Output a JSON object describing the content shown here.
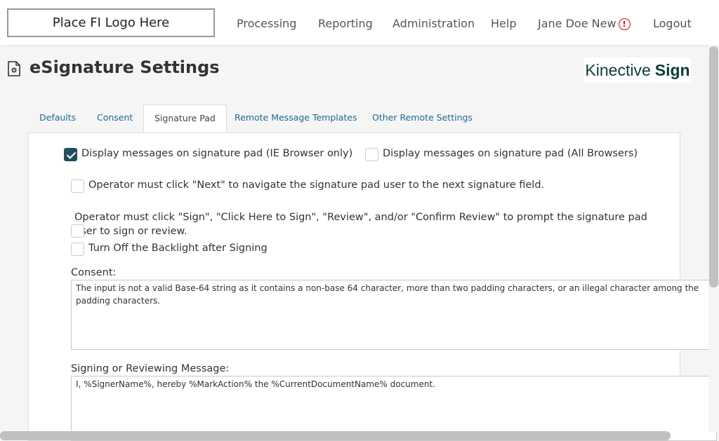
{
  "header": {
    "logo_placeholder": "Place FI Logo Here",
    "nav": {
      "processing": "Processing",
      "reporting": "Reporting",
      "administration": "Administration",
      "help": "Help",
      "user": "Jane Doe New",
      "alert_symbol": "!",
      "logout": "Logout"
    }
  },
  "page": {
    "title": "eSignature Settings",
    "icon": "settings-document-icon",
    "brand_primary": "Kinective",
    "brand_secondary": "Sign"
  },
  "tabs": {
    "defaults": "Defaults",
    "consent": "Consent",
    "signature_pad": "Signature Pad",
    "remote_templates": "Remote Message Templates",
    "other_remote": "Other Remote Settings",
    "active": "Signature Pad"
  },
  "settings": {
    "display_ie": {
      "label": "Display messages on signature pad (IE Browser only)",
      "checked": true
    },
    "display_all": {
      "label": "Display messages on signature pad (All Browsers)",
      "checked": false
    },
    "click_next": {
      "label": "Operator must click \"Next\" to navigate the signature pad user to the next signature field.",
      "checked": false
    },
    "click_sign": {
      "label": "Operator must click \"Sign\", \"Click Here to Sign\", \"Review\", and/or \"Confirm Review\" to prompt the signature pad user to sign or review.",
      "checked": false
    },
    "backlight": {
      "label": "Turn Off the Backlight after Signing",
      "checked": false
    }
  },
  "fields": {
    "consent_label": "Consent:",
    "consent_value": "The input is not a valid Base-64 string as it contains a non-base 64 character, more than two padding characters, or an illegal character among the padding characters.",
    "signing_label": "Signing or Reviewing Message:",
    "signing_value": "I, %SignerName%, hereby %MarkAction% the %CurrentDocumentName% document."
  },
  "colors": {
    "tab_link": "#1e6a8d",
    "checkbox_checked": "#1f4e5e",
    "alert": "#d0021b",
    "brand": "#0e3b3d"
  }
}
